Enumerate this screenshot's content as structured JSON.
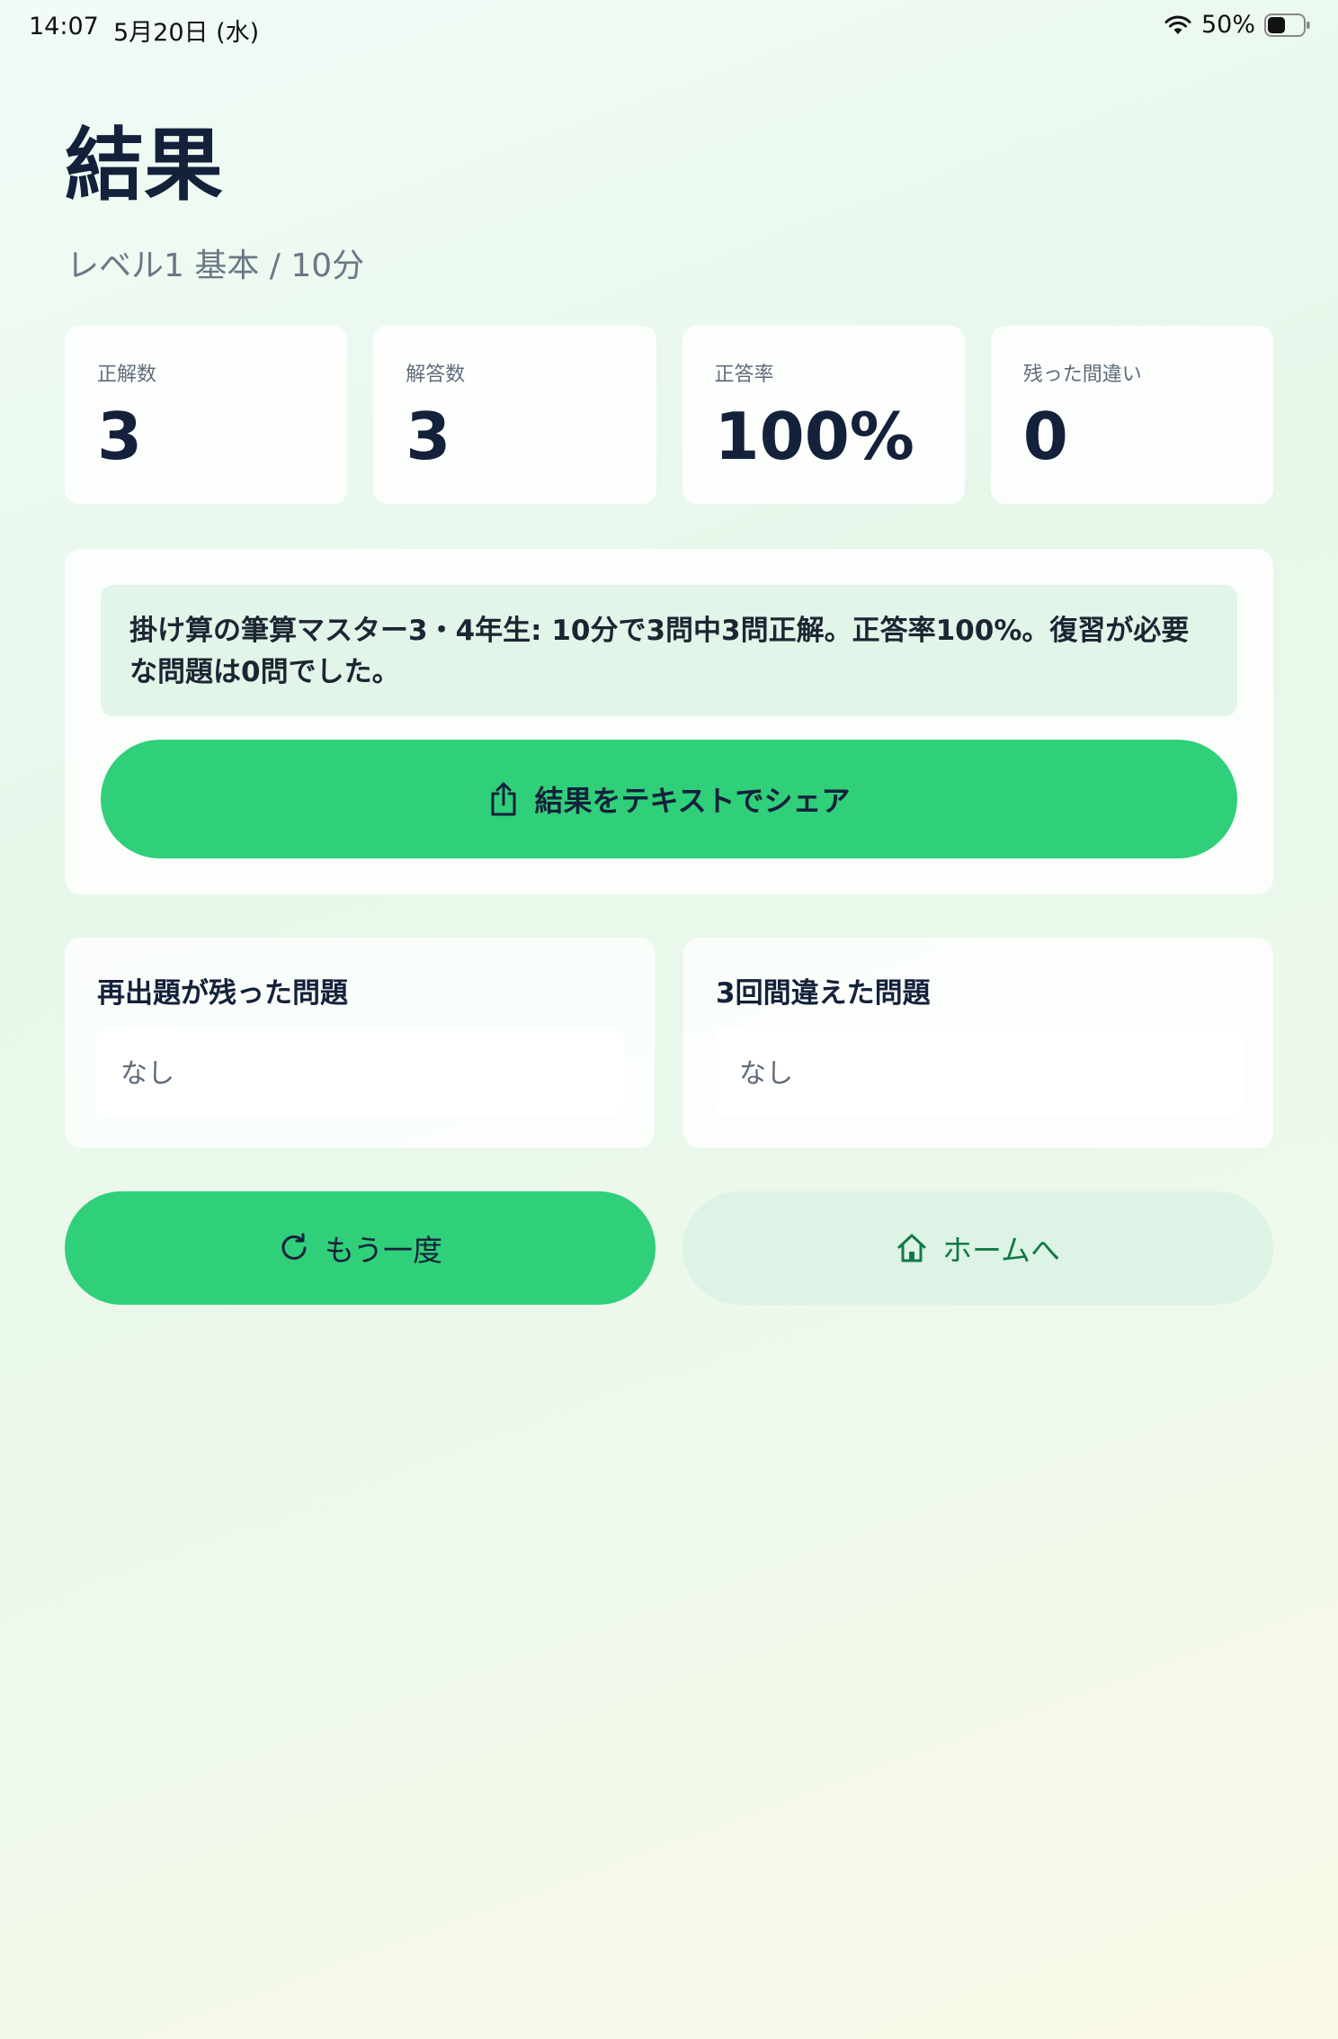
{
  "status_bar": {
    "time": "14:07",
    "date": "5月20日 (水)",
    "battery_percent": "50%",
    "battery_level": 0.5,
    "icons": [
      "wifi-icon",
      "battery-icon"
    ]
  },
  "header": {
    "title": "結果",
    "subtitle": "レベル1 基本 / 10分"
  },
  "stats": [
    {
      "label": "正解数",
      "value": "3"
    },
    {
      "label": "解答数",
      "value": "3"
    },
    {
      "label": "正答率",
      "value": "100%"
    },
    {
      "label": "残った間違い",
      "value": "0"
    }
  ],
  "summary": {
    "text": "掛け算の筆算マスター3・4年生: 10分で3問中3問正解。正答率100%。復習が必要な問題は0問でした。",
    "share_button_label": "結果をテキストでシェア",
    "share_icon": "share-icon"
  },
  "lists": {
    "remaining": {
      "title": "再出題が残った問題",
      "empty_text": "なし"
    },
    "three_wrong": {
      "title": "3回間違えた問題",
      "empty_text": "なし"
    }
  },
  "actions": {
    "retry_label": "もう一度",
    "retry_icon": "refresh-icon",
    "home_label": "ホームへ",
    "home_icon": "home-icon"
  },
  "colors": {
    "accent": "#30cf7a",
    "accent_soft": "#ddf3e6",
    "home_text": "#127a45",
    "text_primary": "#14213a",
    "text_secondary": "#6b7785"
  }
}
